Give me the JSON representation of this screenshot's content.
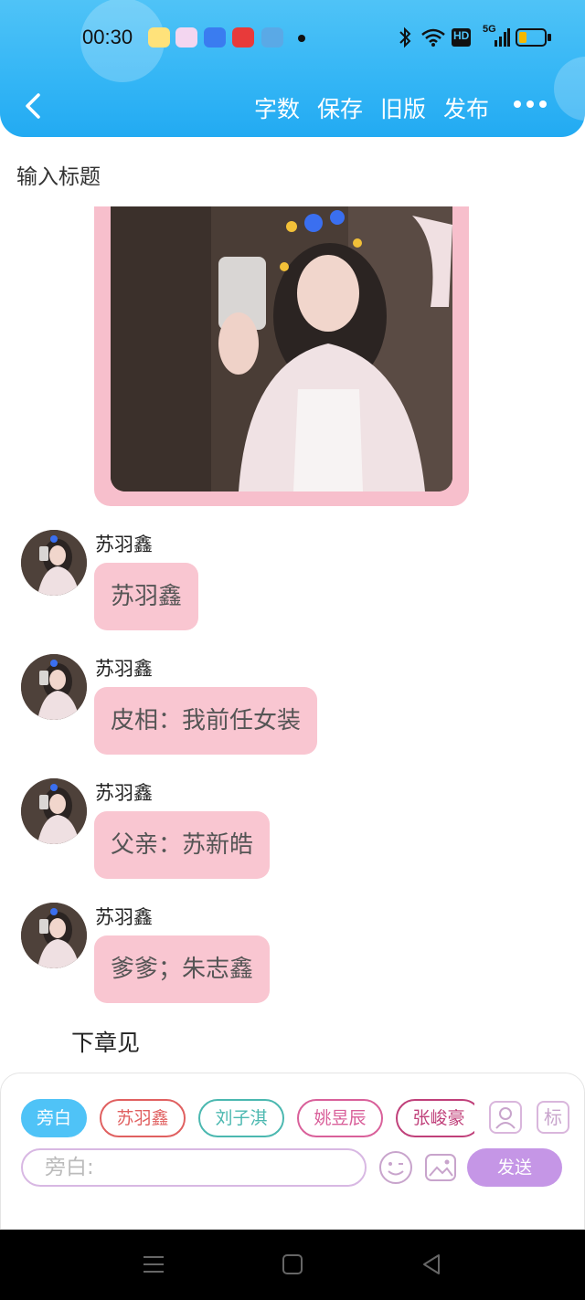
{
  "status_bar": {
    "time": "00:30",
    "network": "HD",
    "signal": "5G"
  },
  "toolbar": {
    "back_icon": "chevron-left-icon",
    "word_count": "字数",
    "save": "保存",
    "old_version": "旧版",
    "publish": "发布",
    "more_icon": "more-dots-icon"
  },
  "title_placeholder": "输入标题",
  "messages": [
    {
      "name": "苏羽鑫",
      "text": "苏羽鑫"
    },
    {
      "name": "苏羽鑫",
      "text": "皮相：我前任女装"
    },
    {
      "name": "苏羽鑫",
      "text": "父亲：苏新皓"
    },
    {
      "name": "苏羽鑫",
      "text": "爹爹；朱志鑫"
    }
  ],
  "narration": "下章见",
  "input_panel": {
    "chips": [
      {
        "label": "旁白",
        "color": "#4fc3f7"
      },
      {
        "label": "苏羽鑫",
        "color": "#e06060"
      },
      {
        "label": "刘子淇",
        "color": "#4bb8b0"
      },
      {
        "label": "姚昱辰",
        "color": "#d9609a"
      },
      {
        "label": "张峻豪",
        "color": "#c0407a"
      }
    ],
    "mark_button": "标",
    "placeholder": "旁白:",
    "send": "发送"
  },
  "colors": {
    "header": "#33b5f5",
    "bubble": "#f9c6d1",
    "send_button": "#c596e6"
  }
}
